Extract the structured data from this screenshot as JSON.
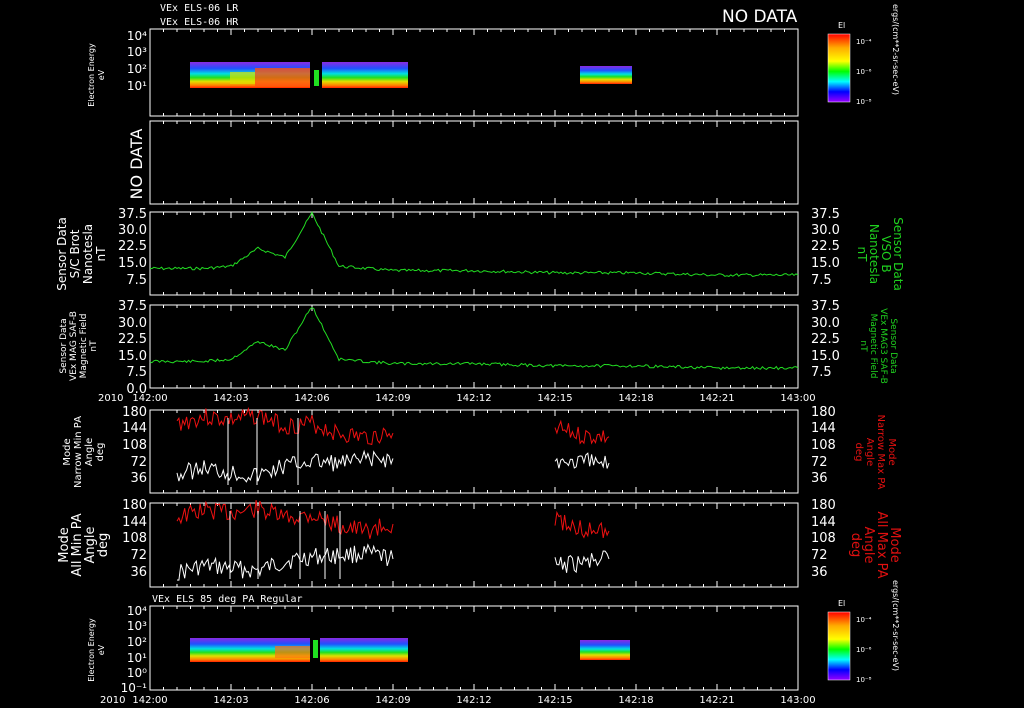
{
  "header": {
    "line1": "VEx ELS-06 LR",
    "line2": "VEx ELS-06 HR",
    "no_data": "NO DATA"
  },
  "time_axis": {
    "year": "2010",
    "ticks": [
      "142:00",
      "142:03",
      "142:06",
      "142:09",
      "142:12",
      "142:15",
      "142:18",
      "142:21",
      "143:00"
    ]
  },
  "colorbar": {
    "title": "El",
    "unit": "ergs/(cm**2-sr-sec-eV)",
    "ticks": [
      "10⁻⁴",
      "10⁻⁶",
      "10⁻⁸"
    ]
  },
  "panels": {
    "p1": {
      "ylabel1": "Electron Energy",
      "ylabel2": "eV",
      "ticks": [
        "10⁴",
        "10³",
        "10²",
        "10¹"
      ]
    },
    "p2": {
      "label": "NO DATA"
    },
    "p3": {
      "left": [
        "Sensor Data",
        "S/C Brot",
        "Nanotesla",
        "nT"
      ],
      "right": [
        "Sensor Data",
        "VSO B",
        "Nanotesla",
        "nT"
      ],
      "ticks": [
        "37.5",
        "30.0",
        "22.5",
        "15.0",
        "7.5"
      ]
    },
    "p4": {
      "left": [
        "Sensor Data",
        "VEx MAG SAF-B",
        "Magnetic Field",
        "nT"
      ],
      "right": [
        "Sensor Data",
        "VEx MAG3 SAF-B",
        "Magnetic Field",
        "nT"
      ],
      "ticks": [
        "37.5",
        "30.0",
        "22.5",
        "15.0",
        "7.5",
        "0.0"
      ]
    },
    "p5": {
      "left": [
        "Mode",
        "Narrow Min PA",
        "Angle",
        "deg"
      ],
      "right": [
        "Mode",
        "Narrow Max PA",
        "Angle",
        "deg"
      ],
      "ticks": [
        "180",
        "144",
        "108",
        "72",
        "36"
      ]
    },
    "p6": {
      "left": [
        "Mode",
        "All Min PA",
        "Angle",
        "deg"
      ],
      "right": [
        "Mode",
        "All Max PA",
        "Angle",
        "deg"
      ],
      "ticks": [
        "180",
        "144",
        "108",
        "72",
        "36"
      ]
    },
    "p7": {
      "title": "VEx ELS 85 deg PA Regular",
      "ylabel1": "Electron Energy",
      "ylabel2": "eV",
      "ticks": [
        "10⁴",
        "10³",
        "10²",
        "10¹",
        "10⁰",
        "10⁻¹"
      ]
    }
  },
  "chart_data": {
    "type": "line",
    "x_unit": "day-of-year:hour",
    "x_range": [
      "142:00",
      "143:00"
    ],
    "spectrogram_data_intervals": [
      [
        "142:01",
        "142:09"
      ],
      [
        "142:15",
        "142:17"
      ]
    ],
    "series": [
      {
        "name": "S/C Brot",
        "ylim": [
          0,
          37.5
        ],
        "x": [
          "142:00",
          "142:01",
          "142:02",
          "142:03",
          "142:04",
          "142:05",
          "142:06",
          "142:07",
          "142:09",
          "142:12",
          "142:15",
          "142:18",
          "142:21",
          "143:00"
        ],
        "y": [
          12,
          12,
          12,
          13,
          21,
          17,
          37,
          13,
          11,
          11,
          10,
          10,
          9,
          9
        ]
      },
      {
        "name": "VEx MAG SAF-B",
        "ylim": [
          0,
          37.5
        ],
        "x": [
          "142:00",
          "142:01",
          "142:02",
          "142:03",
          "142:04",
          "142:05",
          "142:06",
          "142:07",
          "142:09",
          "142:12",
          "142:15",
          "142:18",
          "142:21",
          "143:00"
        ],
        "y": [
          12,
          12,
          12,
          13,
          21,
          17,
          37,
          13,
          11,
          11,
          10,
          10,
          9,
          9
        ]
      },
      {
        "name": "Narrow Max PA",
        "ylim": [
          0,
          180
        ],
        "x": [
          "142:01",
          "142:02",
          "142:03",
          "142:04",
          "142:05",
          "142:06",
          "142:07",
          "142:08",
          "142:09",
          "142:15",
          "142:16",
          "142:17"
        ],
        "y": [
          150,
          165,
          158,
          168,
          145,
          150,
          128,
          120,
          130,
          140,
          125,
          122
        ]
      },
      {
        "name": "Narrow Min PA",
        "ylim": [
          0,
          180
        ],
        "x": [
          "142:01",
          "142:02",
          "142:03",
          "142:04",
          "142:05",
          "142:06",
          "142:07",
          "142:08",
          "142:09",
          "142:15",
          "142:16",
          "142:17"
        ],
        "y": [
          40,
          55,
          45,
          38,
          60,
          70,
          65,
          72,
          75,
          70,
          68,
          65
        ]
      },
      {
        "name": "All Max PA",
        "ylim": [
          0,
          180
        ],
        "x": [
          "142:01",
          "142:02",
          "142:03",
          "142:04",
          "142:05",
          "142:06",
          "142:07",
          "142:08",
          "142:09",
          "142:15",
          "142:16",
          "142:17"
        ],
        "y": [
          150,
          165,
          160,
          168,
          148,
          155,
          132,
          120,
          135,
          145,
          125,
          120
        ]
      },
      {
        "name": "All Min PA",
        "ylim": [
          0,
          180
        ],
        "x": [
          "142:01",
          "142:02",
          "142:03",
          "142:04",
          "142:05",
          "142:06",
          "142:07",
          "142:08",
          "142:09",
          "142:15",
          "142:16",
          "142:17"
        ],
        "y": [
          30,
          45,
          40,
          35,
          55,
          65,
          68,
          72,
          60,
          45,
          52,
          60
        ]
      }
    ]
  }
}
